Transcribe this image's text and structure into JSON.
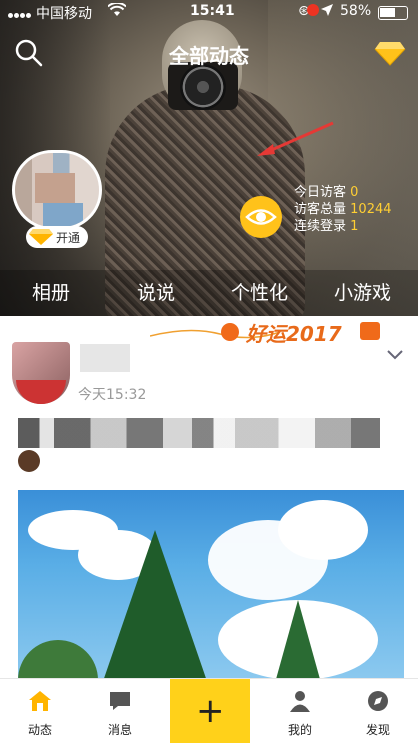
{
  "status_bar": {
    "carrier": "中国移动",
    "time": "15:41",
    "battery": "58%"
  },
  "header": {
    "title": "全部动态",
    "icons": [
      "search-icon",
      "diamond-icon",
      "eye-icon"
    ]
  },
  "profile": {
    "vip_label": "开通",
    "stats": {
      "today_label": "今日访客",
      "today_value": "0",
      "total_label": "访客总量",
      "total_value": "10244",
      "streak_label": "连续登录",
      "streak_value": "1"
    }
  },
  "tabs": [
    "相册",
    "说说",
    "个性化",
    "小游戏"
  ],
  "feed": {
    "banner_text": "好运2017",
    "post_time": "今天15:32"
  },
  "bottom_nav": {
    "items": [
      {
        "label": "动态",
        "icon": "home-icon"
      },
      {
        "label": "消息",
        "icon": "message-icon"
      },
      {
        "label": "我的",
        "icon": "person-icon"
      },
      {
        "label": "发现",
        "icon": "discover-icon"
      }
    ],
    "plus_label": "+"
  },
  "colors": {
    "accent": "#ffc21a",
    "stat_number": "#ffcf33",
    "notification": "#e32222"
  }
}
